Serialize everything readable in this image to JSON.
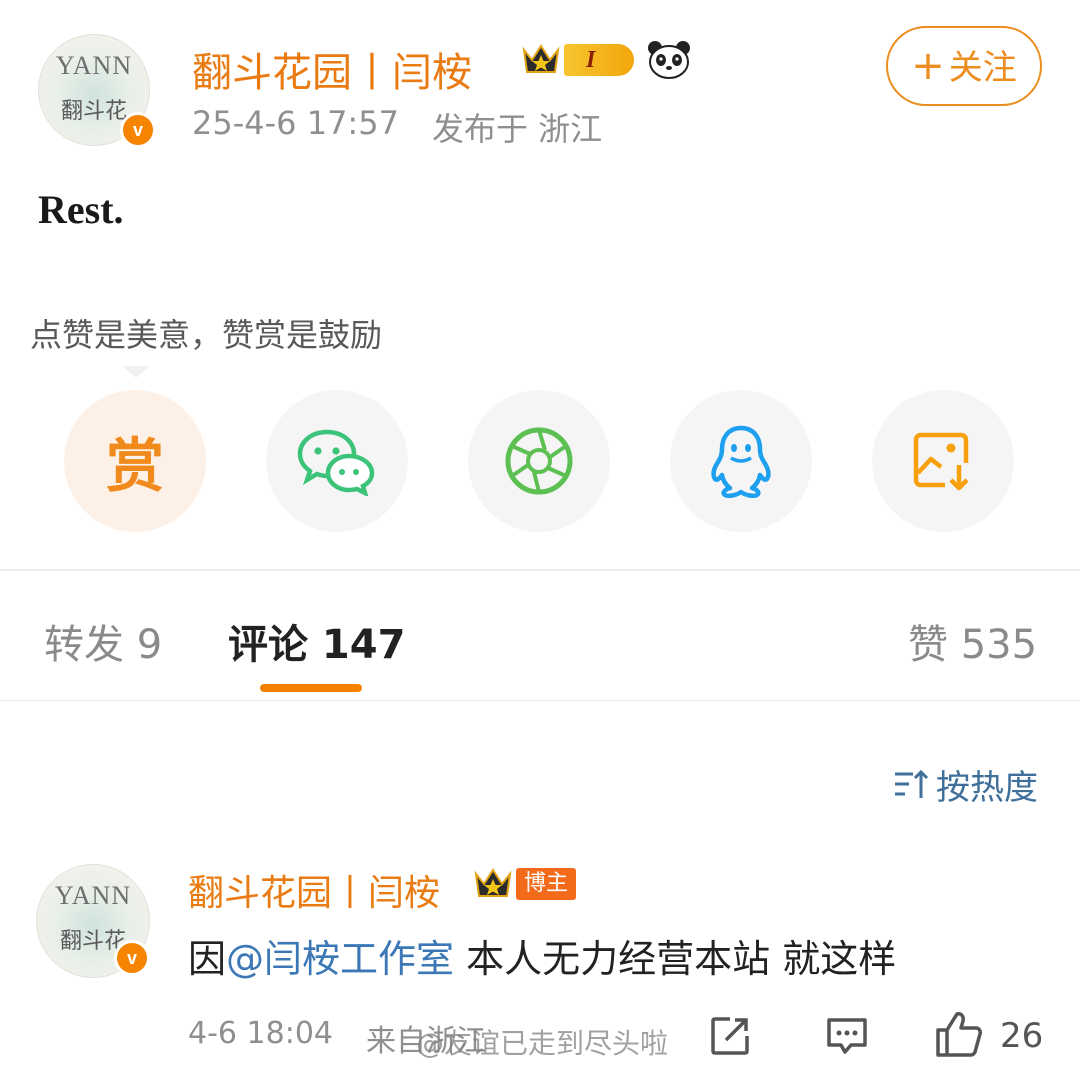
{
  "post": {
    "author": "翻斗花园丨闫桉",
    "avatar_mark": "YANN",
    "avatar_sub": "翻斗花",
    "verified_mark": "v",
    "level": "I",
    "timestamp": "25-4-6 17:57",
    "location": "发布于 浙江",
    "follow_plus": "+",
    "follow_label": "关注",
    "text": "Rest."
  },
  "share_panel": {
    "tip": "点赞是美意，赞赏是鼓励",
    "reward_label": "赏",
    "items": [
      "reward-icon",
      "wechat-icon",
      "moments-icon",
      "qq-icon",
      "save-image-icon"
    ]
  },
  "tabs": {
    "repost": "转发 9",
    "comments": "评论 147",
    "likes": "赞 535"
  },
  "sort_label": "按热度",
  "comment": {
    "author": "翻斗花园丨闫桉",
    "tag": "博主",
    "text_prefix": "因",
    "mention": "@闫桉工作室",
    "text_suffix": " 本人无力经营本站 就这样",
    "time": "4-6 18:04",
    "source": "来自浙江",
    "like_count": "26"
  },
  "watermark": "@友谊已走到尽头啦",
  "colors": {
    "accent_orange": "#e97b12",
    "link_blue": "#3b78b5",
    "tab_underline": "#f58200",
    "wechat_green": "#3cc37a",
    "qq_blue": "#1ea0f0"
  }
}
